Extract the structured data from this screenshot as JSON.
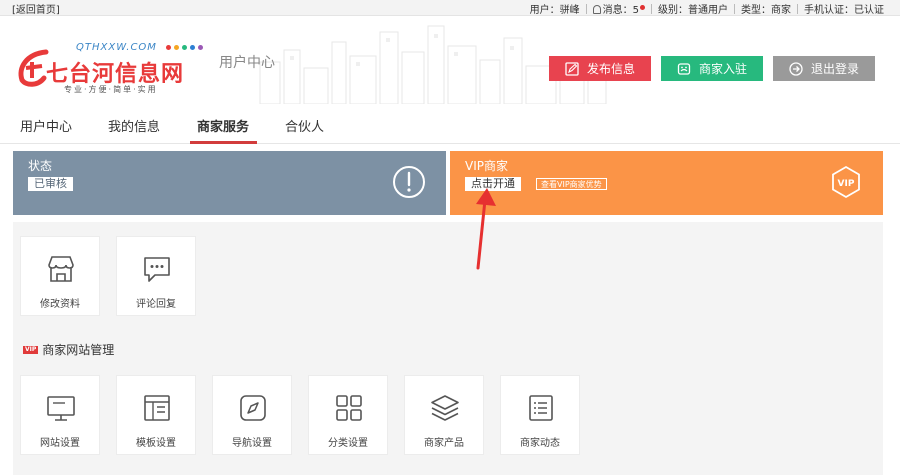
{
  "topbar": {
    "back": "[返回首页]",
    "user_label": "用户：骈峰",
    "messages_label": "消息：",
    "messages_count": "5",
    "level_label": "级别：普通用户",
    "type_label": "类型：商家",
    "phone_label": "手机认证：已认证"
  },
  "header": {
    "logo_sub": "QTHXXW.COM",
    "logo_main": "七台河信息网",
    "logo_tag": "专业·方便·简单·实用",
    "section_title": "用户中心",
    "buttons": {
      "publish": "发布信息",
      "join": "商家入驻",
      "logout": "退出登录"
    }
  },
  "nav": {
    "tabs": [
      "用户中心",
      "我的信息",
      "商家服务",
      "合伙人"
    ],
    "active": "商家服务"
  },
  "cards": {
    "status": {
      "title": "状态",
      "value": "已审核"
    },
    "vip": {
      "title": "VIP商家",
      "action": "点击开通",
      "link": "查看VIP商家优势",
      "badge": "VIP"
    }
  },
  "tiles_top": [
    {
      "label": "修改资料",
      "icon": "shop-icon"
    },
    {
      "label": "评论回复",
      "icon": "comment-icon"
    }
  ],
  "section": {
    "badge": "VIP",
    "title": "商家网站管理"
  },
  "tiles_site": [
    {
      "label": "网站设置",
      "icon": "monitor-icon"
    },
    {
      "label": "模板设置",
      "icon": "template-icon"
    },
    {
      "label": "导航设置",
      "icon": "compass-icon"
    },
    {
      "label": "分类设置",
      "icon": "grid-icon"
    },
    {
      "label": "商家产品",
      "icon": "layers-icon"
    },
    {
      "label": "商家动态",
      "icon": "list-icon"
    }
  ],
  "colors": {
    "publish": "#e8434f",
    "join": "#27b97e",
    "logout": "#9a9a9a",
    "status_card": "#7d91a4",
    "vip_card": "#fb9447",
    "active_tab_underline": "#d23c3c"
  }
}
